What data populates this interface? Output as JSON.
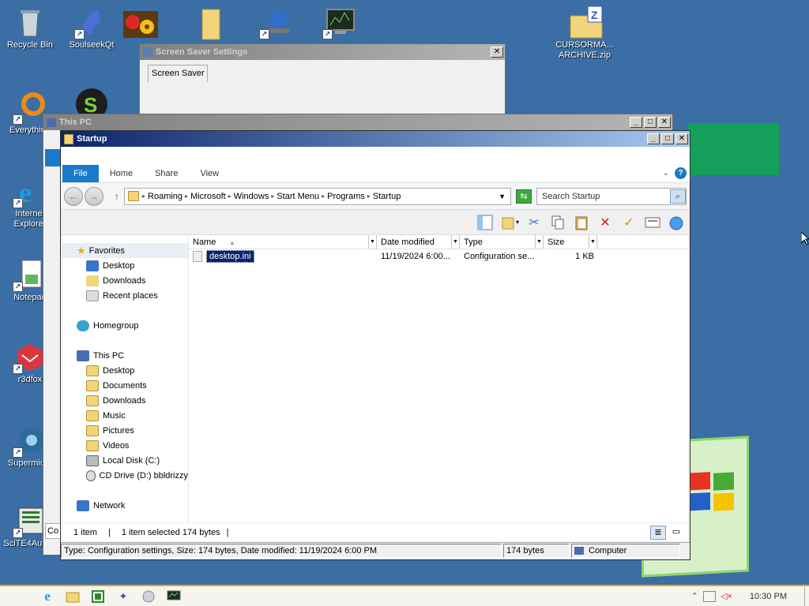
{
  "desktop": {
    "icons_left": [
      {
        "label": "Recycle Bin"
      },
      {
        "label": "SoulseekQt"
      },
      {
        "label": "Everything"
      },
      {
        "label": "Internet Explorer"
      },
      {
        "label": "Notepad"
      },
      {
        "label": "r3dfox"
      },
      {
        "label": "Supermium"
      },
      {
        "label": "SciTE4Auto..."
      }
    ],
    "icon_right_label": "CURSORMA... ARCHIVE.zip",
    "background_color": "#3a6ea5"
  },
  "screensaver_window": {
    "title": "Screen Saver Settings",
    "tab": "Screen Saver"
  },
  "thispc_window": {
    "title": "This PC"
  },
  "explorer": {
    "title": "Startup",
    "tabs": [
      "File",
      "Home",
      "Share",
      "View"
    ],
    "breadcrumb": [
      "Roaming",
      "Microsoft",
      "Windows",
      "Start Menu",
      "Programs",
      "Startup"
    ],
    "search_placeholder": "Search Startup",
    "nav": {
      "favorites_label": "Favorites",
      "favorites": [
        "Desktop",
        "Downloads",
        "Recent places"
      ],
      "homegroup_label": "Homegroup",
      "thispc_label": "This PC",
      "thispc_items": [
        "Desktop",
        "Documents",
        "Downloads",
        "Music",
        "Pictures",
        "Videos",
        "Local Disk (C:)",
        "CD Drive (D:) bbldrizzy"
      ],
      "network_label": "Network"
    },
    "columns": [
      "Name",
      "Date modified",
      "Type",
      "Size"
    ],
    "files": [
      {
        "name": "desktop.ini",
        "date": "11/19/2024 6:00...",
        "type": "Configuration se...",
        "size": "1 KB"
      }
    ],
    "status": {
      "count": "1 item",
      "selected": "1 item selected  174 bytes"
    },
    "statusbar2": {
      "info": "Type: Configuration settings, Size: 174 bytes, Date modified: 11/19/2024 6:00 PM",
      "size": "174 bytes",
      "location": "Computer"
    }
  },
  "taskbar": {
    "clock": "10:30 PM"
  }
}
